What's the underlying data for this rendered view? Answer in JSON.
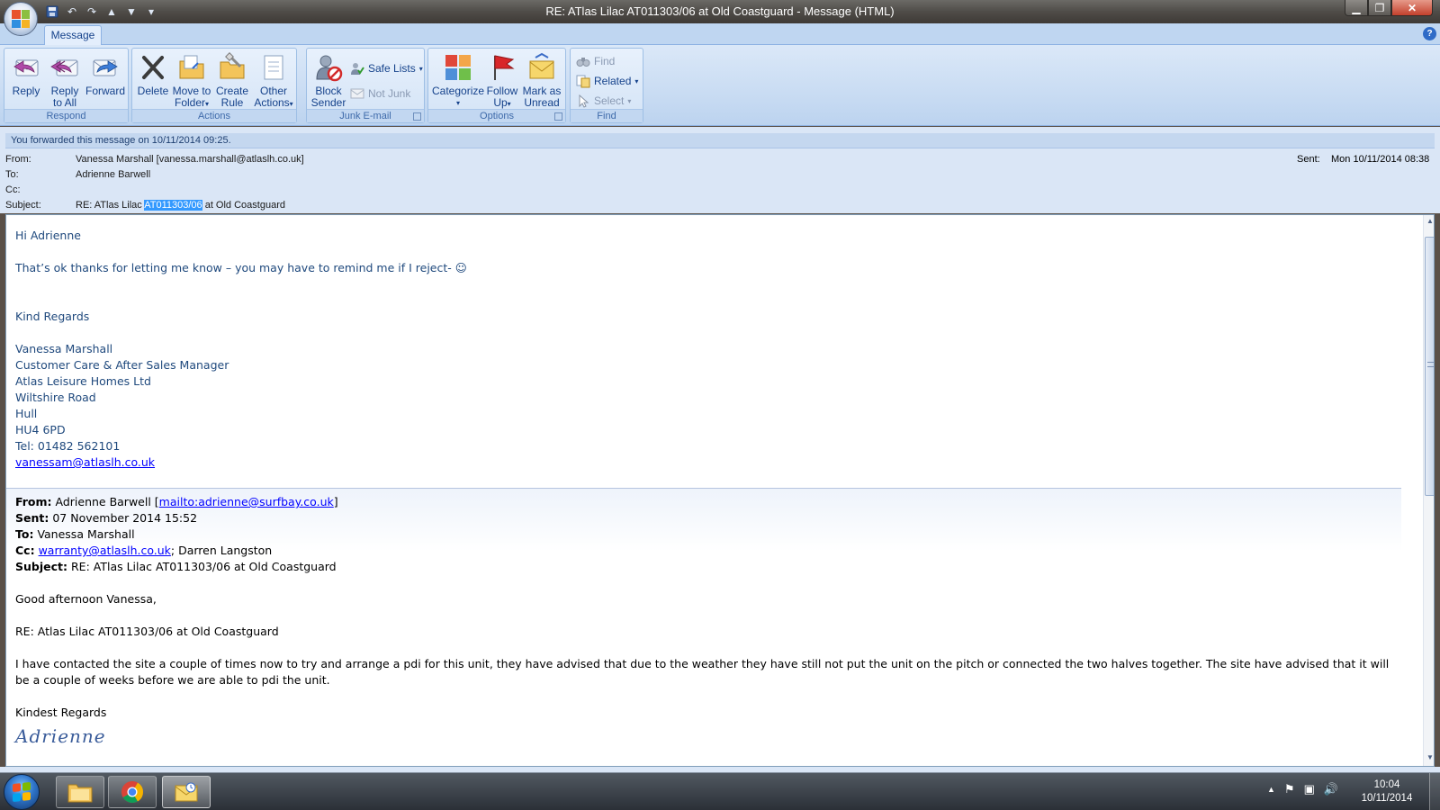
{
  "window": {
    "title": "RE: ATlas Lilac AT011303/06 at Old Coastguard - Message (HTML)",
    "min_glyph": "▁",
    "max_glyph": "❐",
    "close_glyph": "✕",
    "help_glyph": "?"
  },
  "qat": {
    "save_glyph": "💾",
    "undo_glyph": "↶",
    "redo_glyph": "↷",
    "up_glyph": "▲",
    "down_glyph": "▼",
    "customize_glyph": "▾"
  },
  "ribbon": {
    "tab": "Message",
    "groups": {
      "respond": "Respond",
      "actions": "Actions",
      "junk": "Junk E-mail",
      "options": "Options",
      "find": "Find"
    },
    "buttons": {
      "reply": "Reply",
      "reply_all_1": "Reply",
      "reply_all_2": "to All",
      "forward": "Forward",
      "delete": "Delete",
      "move_1": "Move to",
      "move_2": "Folder",
      "create_1": "Create",
      "create_2": "Rule",
      "other_1": "Other",
      "other_2": "Actions",
      "block_1": "Block",
      "block_2": "Sender",
      "safe_lists": "Safe Lists",
      "not_junk": "Not Junk",
      "categorize": "Categorize",
      "follow_1": "Follow",
      "follow_2": "Up",
      "mark_1": "Mark as",
      "mark_2": "Unread",
      "find": "Find",
      "related": "Related",
      "select": "Select"
    }
  },
  "header": {
    "info_bar": "You forwarded this message on 10/11/2014 09:25.",
    "from_label": "From:",
    "from_value": "Vanessa Marshall [vanessa.marshall@atlaslh.co.uk]",
    "to_label": "To:",
    "to_value": "Adrienne Barwell",
    "cc_label": "Cc:",
    "subject_label": "Subject:",
    "subject_before": "RE: ATlas Lilac ",
    "subject_highlight": "AT011303/06",
    "subject_after": " at Old Coastguard",
    "sent_label": "Sent:",
    "sent_value": "Mon 10/11/2014 08:38"
  },
  "body": {
    "greeting": "Hi Adrienne",
    "line1": "That’s ok thanks for letting me know – you may have to remind me if I reject- ☺",
    "regards": "Kind Regards",
    "sig": [
      "Vanessa Marshall",
      "Customer Care & After Sales Manager",
      "Atlas Leisure Homes Ltd",
      "Wiltshire Road",
      "Hull",
      "HU4 6PD",
      "Tel: 01482 562101"
    ],
    "sig_email": "vanessam@atlaslh.co.uk",
    "quoted": {
      "from_label": "From:",
      "from_name": "Adrienne Barwell [",
      "from_link": "mailto:adrienne@surfbay.co.uk",
      "from_close": "]",
      "sent_label": "Sent:",
      "sent_value": "07 November 2014 15:52",
      "to_label": "To:",
      "to_value": "Vanessa Marshall",
      "cc_label": "Cc:",
      "cc_link": "warranty@atlaslh.co.uk",
      "cc_rest": "; Darren Langston",
      "subject_label": "Subject:",
      "subject_value": "RE: ATlas Lilac AT011303/06 at Old Coastguard",
      "greeting": "Good afternoon Vanessa,",
      "re_line": "RE: Atlas Lilac AT011303/06 at Old Coastguard",
      "paragraph": "I have contacted the site a couple of times now to try and arrange a pdi for this unit, they have advised that due to the weather they have still not put the unit on the pitch or connected the two halves together.  The site have advised that it will be a couple of weeks before we are able to pdi the unit.",
      "closing": "Kindest Regards",
      "signature": "Adrienne"
    }
  },
  "taskbar": {
    "clock_time": "10:04",
    "clock_date": "10/11/2014",
    "tray_up": "▲",
    "tray_flag": "⚑",
    "tray_network": "▣",
    "tray_volume": "🔊"
  },
  "colors": {
    "ribbon_text": "#15428b",
    "body_text": "#1f497d",
    "highlight": "#3399ff",
    "link": "#0000ff"
  }
}
